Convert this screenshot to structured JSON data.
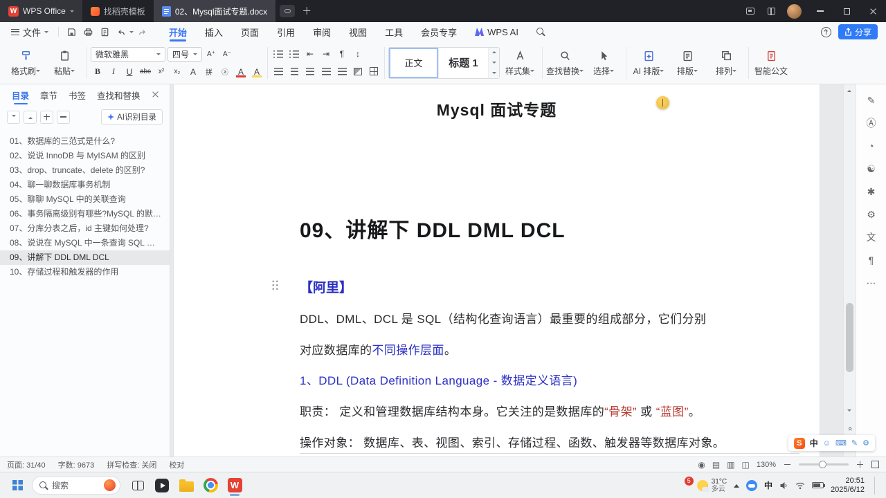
{
  "glyphs": {
    "plus": "＋",
    "outdent": "⇤",
    "indent": "⇥",
    "pilcrow": "¶",
    "line_spacing": "↕",
    "double_chevron": "«"
  },
  "titlebar": {
    "wps_logo": "W",
    "home_tab": "WPS Office",
    "template_tab": "找稻壳模板",
    "doc_tab": "02、Mysql面试专题.docx"
  },
  "menubar": {
    "file": "文件",
    "tabs": [
      "开始",
      "插入",
      "页面",
      "引用",
      "审阅",
      "视图",
      "工具",
      "会员专享",
      "WPS AI"
    ],
    "share": "分享"
  },
  "ribbon": {
    "format_painter": "格式刷",
    "paste": "粘贴",
    "font_name": "微软雅黑",
    "font_size": "四号",
    "buttons": {
      "grow_font": "A⁺",
      "shrink_font": "A⁻",
      "bold": "B",
      "italic": "I",
      "underline": "U",
      "strike": "abc",
      "superscript": "x²",
      "subscript": "x₂",
      "clear_format": "A",
      "pinyin": "拼",
      "enclose": "ⓐ",
      "font_color": "A",
      "highlight": "A"
    },
    "style_body": "正文",
    "style_heading1": "标题 1",
    "style_set": "样式集",
    "find_replace": "查找替换",
    "select": "选择",
    "ai_layout": "AI 排版",
    "layout": "排版",
    "arrange": "排列",
    "smart_doc": "智能公文"
  },
  "sidebar": {
    "tabs": [
      "目录",
      "章节",
      "书签",
      "查找和替换"
    ],
    "ai_button": "AI识别目录",
    "items": [
      "01、数据库的三范式是什么?",
      "02、说说 InnoDB 与 MyISAM 的区别",
      "03、drop、truncate、delete 的区别?",
      "04、聊一聊数据库事务机制",
      "05、聊聊 MySQL 中的关联查询",
      "06、事务隔离级别有哪些?MySQL 的默认...",
      "07、分库分表之后，id 主键如何处理?",
      "08、说说在 MySQL 中一条查询 SQL 是...",
      "09、讲解下 DDL DML DCL",
      "10、存储过程和触发器的作用"
    ]
  },
  "document": {
    "title": "Mysql 面试专题",
    "heading": "09、讲解下 DDL DML DCL",
    "tag": "【阿里】",
    "p1_line1": "DDL、DML、DCL 是 SQL（结构化查询语言）最重要的组成部分，它们分别",
    "p1_line2_pre": "对应数据库的",
    "p1_line2_link": "不同操作层面",
    "p1_line2_post": "。",
    "sub1": "1、DDL (Data Definition Language - 数据定义语言)",
    "p2_pre": "职责： 定义和管理数据库结构本身。它关注的是数据库的",
    "p2_term1": "“骨架”",
    "p2_mid": " 或 ",
    "p2_term2": "“蓝图”",
    "p2_post": "。",
    "p3": "操作对象： 数据库、表、视图、索引、存储过程、函数、触发器等数据库对象。"
  },
  "sidetools": {
    "icons": [
      "✎",
      "Ⓐ",
      "◔",
      "☯",
      "✱",
      "⚙",
      "文",
      "¶",
      "⋯"
    ]
  },
  "ime": {
    "logo": "S",
    "mode": "中",
    "icons": [
      "☺",
      "⌨",
      "✎",
      "⚙"
    ]
  },
  "statusbar": {
    "page": "页面: 31/40",
    "words": "字数: 9673",
    "spellcheck": "拼写检查: 关闭",
    "proofread": "校对",
    "view_icons": [
      "◉",
      "▤",
      "▥",
      "◫"
    ],
    "zoom": "130%"
  },
  "taskbar": {
    "search": "搜索",
    "badge": "5",
    "temperature": "31°C",
    "weather": "多云",
    "ime_mode": "中",
    "time": "20:51",
    "date": "2025/6/12",
    "wps_logo": "W"
  }
}
